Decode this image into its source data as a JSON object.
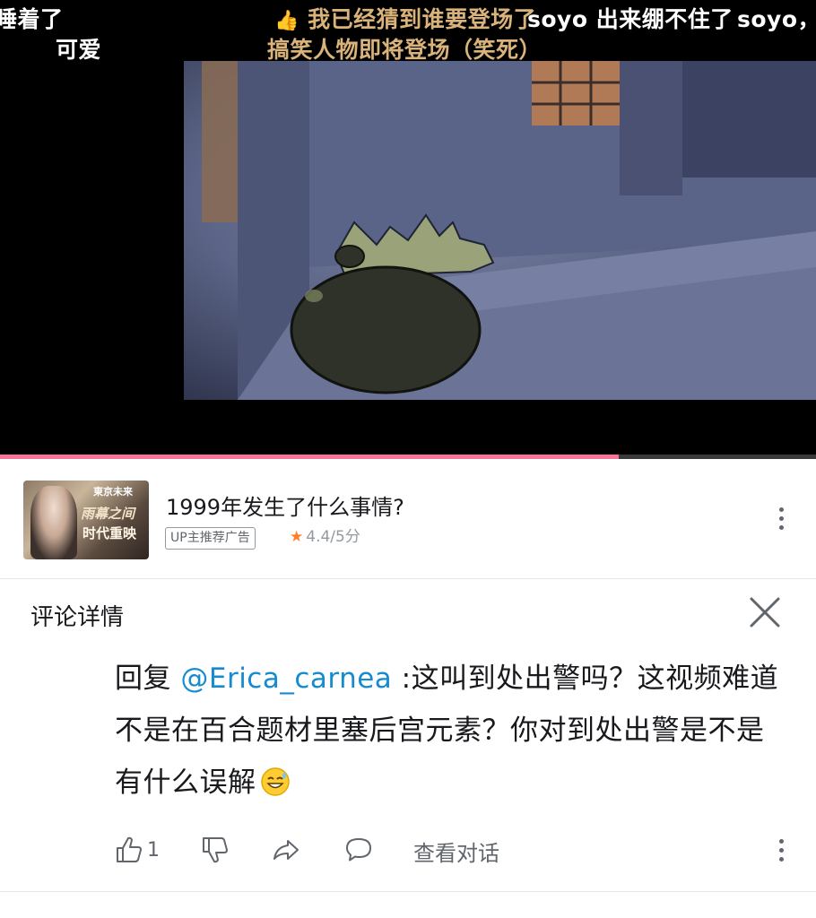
{
  "player": {
    "danmaku": [
      {
        "text": "睡着了",
        "color": "#ffffff"
      },
      {
        "text": "可爱",
        "color": "#ffffff"
      },
      {
        "text": "我已经猜到谁要登场了",
        "color": "#d9b37a"
      },
      {
        "text": "soyo 出来绷不住了",
        "color": "#ffffff"
      },
      {
        "text": "soyo，",
        "color": "#ffffff"
      },
      {
        "text": "搞笑人物即将登场（笑死）",
        "color": "#d9b37a"
      }
    ],
    "progress": 0.758,
    "progress_color": "#fb7299"
  },
  "ad": {
    "thumb_text_1": "東京未来",
    "thumb_text_2": "雨幕之间",
    "thumb_text_3": "时代重映",
    "title": "1999年发生了什么事情?",
    "badge": "UP主推荐广告",
    "rating": "4.4/5分"
  },
  "detail": {
    "title": "评论详情"
  },
  "comment": {
    "reply_prefix": "回复 ",
    "mention": "@Erica_carnea",
    "text": " :这叫到处出警吗？这视频难道不是在百合题材里塞后宫元素？你对到处出警是不是有什么误解",
    "mention_color": "#178bcf"
  },
  "actions": {
    "like_count": "1",
    "view_conversation": "查看对话"
  }
}
